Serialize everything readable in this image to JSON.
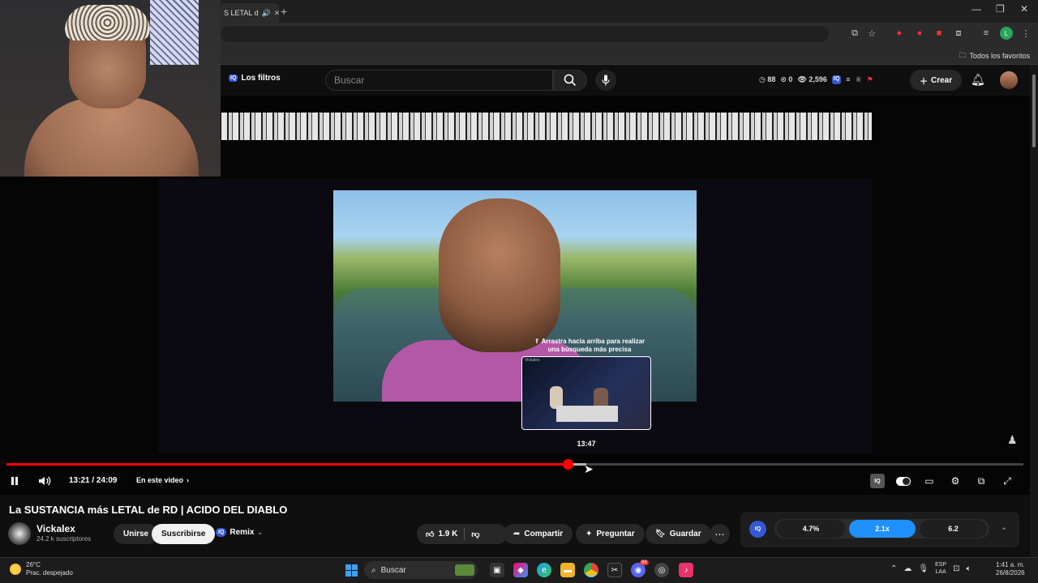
{
  "browser": {
    "tab_title": "S LETAL d",
    "new_tab_label": "+",
    "bookmarks_folder": "Todos los favoritos"
  },
  "youtube_header": {
    "filters_label": "Los filtros",
    "filters_badge": "IQ",
    "search_placeholder": "Buscar",
    "stats": {
      "views": "88",
      "zero": "0",
      "count": "2,596"
    },
    "crear_label": "Crear"
  },
  "player": {
    "drag_hint": "⇑ Arrastra hacia arriba para realizar una búsqueda más precisa",
    "preview_channel_tag": "Vickalex",
    "preview_time": "13:47",
    "current_time": "13:21",
    "duration": "24:09",
    "time_display": "13:21 / 24:09",
    "chapters_label": "En este video",
    "progress_fraction": 0.552,
    "hover_fraction": 0.57,
    "controls": {
      "iq_badge": "IQ"
    }
  },
  "video_info": {
    "title": "La SUSTANCIA más LETAL de RD | ACIDO DEL DIABLO",
    "channel_name": "Vickalex",
    "subscribers": "24.2 k suscriptores",
    "join_label": "Unirse",
    "subscribe_label": "Suscribirse",
    "remix_label": "Remix",
    "remix_badge": "IQ",
    "likes": "1.9 K",
    "share_label": "Compartir",
    "ask_label": "Preguntar",
    "save_label": "Guardar",
    "more_label": "⋯"
  },
  "iq_panel": {
    "logo": "IQ",
    "value_1": "4.7%",
    "value_2": "2.1x",
    "value_3": "6.2"
  },
  "taskbar": {
    "temperature": "26°C",
    "weather": "Prac. despejado",
    "search_label": "Buscar",
    "lang_1": "ESP",
    "lang_2": "LAA",
    "time": "1:41 a. m.",
    "date": "26/8/2026",
    "discord_badge": "99"
  },
  "colors": {
    "progress": "#ff0000",
    "iq_brand": "#3457d5",
    "iq_active": "#1e90ff"
  }
}
